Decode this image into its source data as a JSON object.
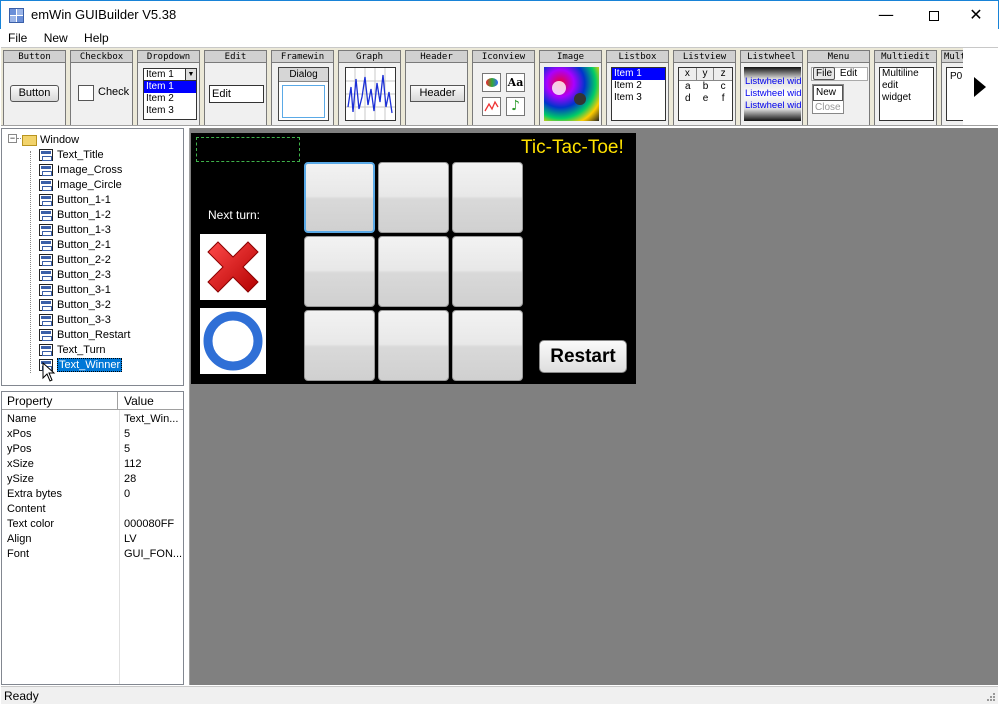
{
  "window": {
    "title": "emWin GUIBuilder V5.38",
    "minimize_glyph": "—",
    "close_glyph": "✕"
  },
  "menu": {
    "items": [
      "File",
      "New",
      "Help"
    ]
  },
  "toolbar": {
    "tools": [
      {
        "title": "Button",
        "sample": "Button"
      },
      {
        "title": "Checkbox",
        "sample": "Check"
      },
      {
        "title": "Dropdown",
        "selected": "Item 1",
        "items": [
          "Item 1",
          "Item 2",
          "Item 3"
        ]
      },
      {
        "title": "Edit",
        "sample": "Edit"
      },
      {
        "title": "Framewin",
        "sample": "Dialog"
      },
      {
        "title": "Graph"
      },
      {
        "title": "Header",
        "sample": "Header"
      },
      {
        "title": "Iconview",
        "sample": "Aa"
      },
      {
        "title": "Image"
      },
      {
        "title": "Listbox",
        "items": [
          "Item 1",
          "Item 2",
          "Item 3"
        ]
      },
      {
        "title": "Listview",
        "cells": [
          "x",
          "y",
          "z",
          "a",
          "b",
          "c",
          "d",
          "e",
          "f"
        ]
      },
      {
        "title": "Listwheel",
        "items": [
          "Listwheel wid",
          "Listwheel wid",
          "Listwheel wid"
        ]
      },
      {
        "title": "Menu",
        "items": [
          "File",
          "Edit",
          "New",
          "Close"
        ]
      },
      {
        "title": "Multiedit",
        "lines": [
          "Multiline",
          "edit",
          "widget"
        ]
      },
      {
        "title": "Mult",
        "sample": "P0"
      }
    ]
  },
  "tree": {
    "root": "Window",
    "expander": "−",
    "children": [
      "Text_Title",
      "Image_Cross",
      "Image_Circle",
      "Button_1-1",
      "Button_1-2",
      "Button_1-3",
      "Button_2-1",
      "Button_2-2",
      "Button_2-3",
      "Button_3-1",
      "Button_3-2",
      "Button_3-3",
      "Button_Restart",
      "Text_Turn",
      "Text_Winner"
    ],
    "selected": "Text_Winner"
  },
  "properties": {
    "header_property": "Property",
    "header_value": "Value",
    "rows": [
      {
        "key": "Name",
        "value": "Text_Win..."
      },
      {
        "key": "xPos",
        "value": "5"
      },
      {
        "key": "yPos",
        "value": "5"
      },
      {
        "key": "xSize",
        "value": "112"
      },
      {
        "key": "ySize",
        "value": "28"
      },
      {
        "key": "Extra bytes",
        "value": "0"
      },
      {
        "key": "Content",
        "value": ""
      },
      {
        "key": "Text color",
        "value": "000080FF"
      },
      {
        "key": "Align",
        "value": "LV"
      },
      {
        "key": "Font",
        "value": "GUI_FON..."
      }
    ]
  },
  "dialog": {
    "title": "Tic-Tac-Toe!",
    "next_turn": "Next turn:",
    "restart": "Restart",
    "title_color": "#ffe100",
    "background": "#000000",
    "cells": [
      "Button_1-1",
      "Button_1-2",
      "Button_1-3",
      "Button_2-1",
      "Button_2-2",
      "Button_2-3",
      "Button_3-1",
      "Button_3-2",
      "Button_3-3"
    ]
  },
  "status": {
    "text": "Ready"
  }
}
